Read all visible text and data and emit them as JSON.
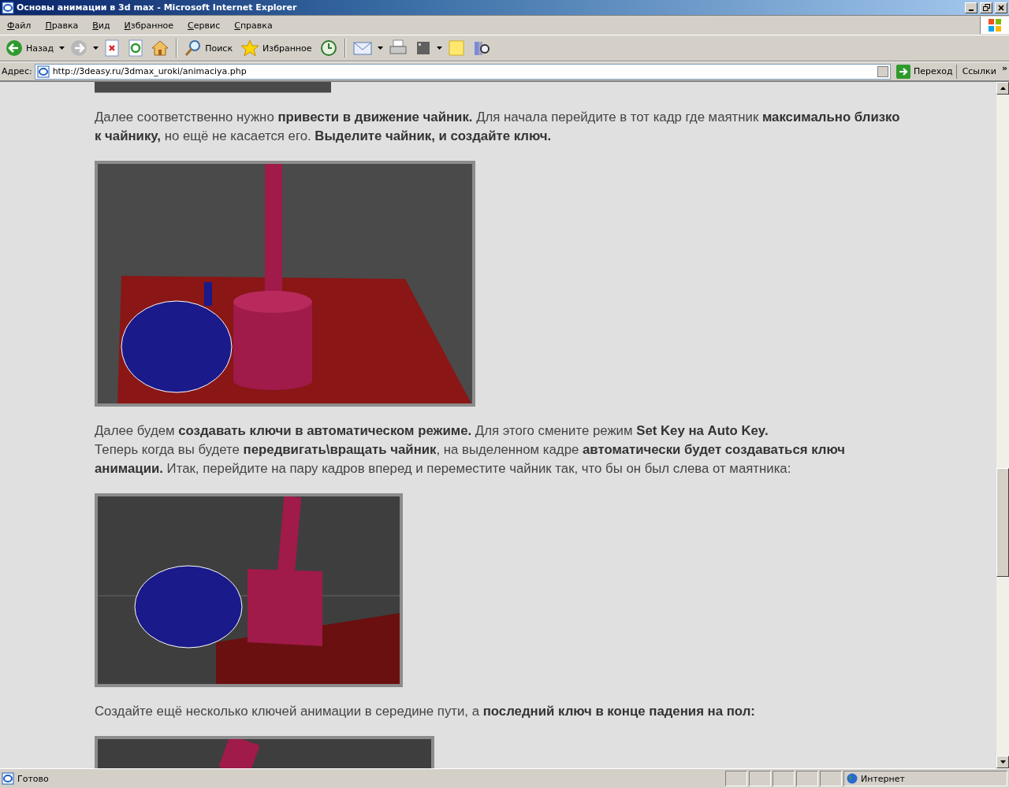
{
  "window": {
    "title": "Основы анимации в 3d max - Microsoft Internet Explorer"
  },
  "menu": [
    "Файл",
    "Правка",
    "Вид",
    "Избранное",
    "Сервис",
    "Справка"
  ],
  "toolbar": {
    "back": "Назад",
    "search": "Поиск",
    "favorites": "Избранное"
  },
  "address_bar": {
    "label": "Адрес:",
    "url": "http://3deasy.ru/3dmax_uroki/animaciya.php",
    "go": "Переход",
    "links": "Ссылки",
    "more": "»"
  },
  "content": [
    {
      "kind": "image"
    },
    {
      "kind": "text",
      "lines": [
        "Далее соответственно нужно **привести в движение чайник.** Для начала перейдите в тот кадр где маятник **максимально близко к чайнику,** но ещё не касается его. **Выделите чайник, и создайте ключ.**"
      ]
    },
    {
      "kind": "image"
    },
    {
      "kind": "text",
      "lines": [
        "Далее будем **создавать ключи в автоматическом режиме.** Для этого смените режим **Set Key на Auto Key.**",
        "Теперь когда вы будете **передвигать\\вращать чайник**, на выделенном кадре **автоматически будет создаваться ключ анимации.** Итак, перейдите на пару кадров вперед и переместите чайник так, что бы он был слева от маятника:"
      ]
    },
    {
      "kind": "image"
    },
    {
      "kind": "text",
      "lines": [
        "Создайте ещё несколько ключей анимации в середине пути, а **последний ключ в конце падения на пол:**"
      ]
    },
    {
      "kind": "image"
    }
  ],
  "status_bar": {
    "text": "Готово",
    "zone": "Интернет"
  }
}
